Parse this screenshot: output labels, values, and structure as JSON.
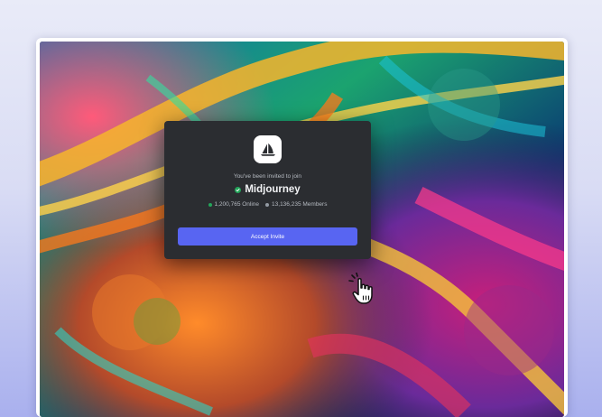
{
  "invite": {
    "intro_text": "You've been invited to join",
    "server_name": "Midjourney",
    "online_count": "1,200,765 Online",
    "member_count": "13,136,235 Members",
    "accept_label": "Accept Invite",
    "verified_icon": "check-icon",
    "server_icon": "sailboat-logo-icon"
  },
  "colors": {
    "card_background": "#2b2d31",
    "accent": "#5865f2",
    "online_status": "#23a55a",
    "members_status": "#949ba4",
    "page_background": "#e9ebf8"
  },
  "cursor": {
    "icon": "hand-pointer-icon"
  }
}
